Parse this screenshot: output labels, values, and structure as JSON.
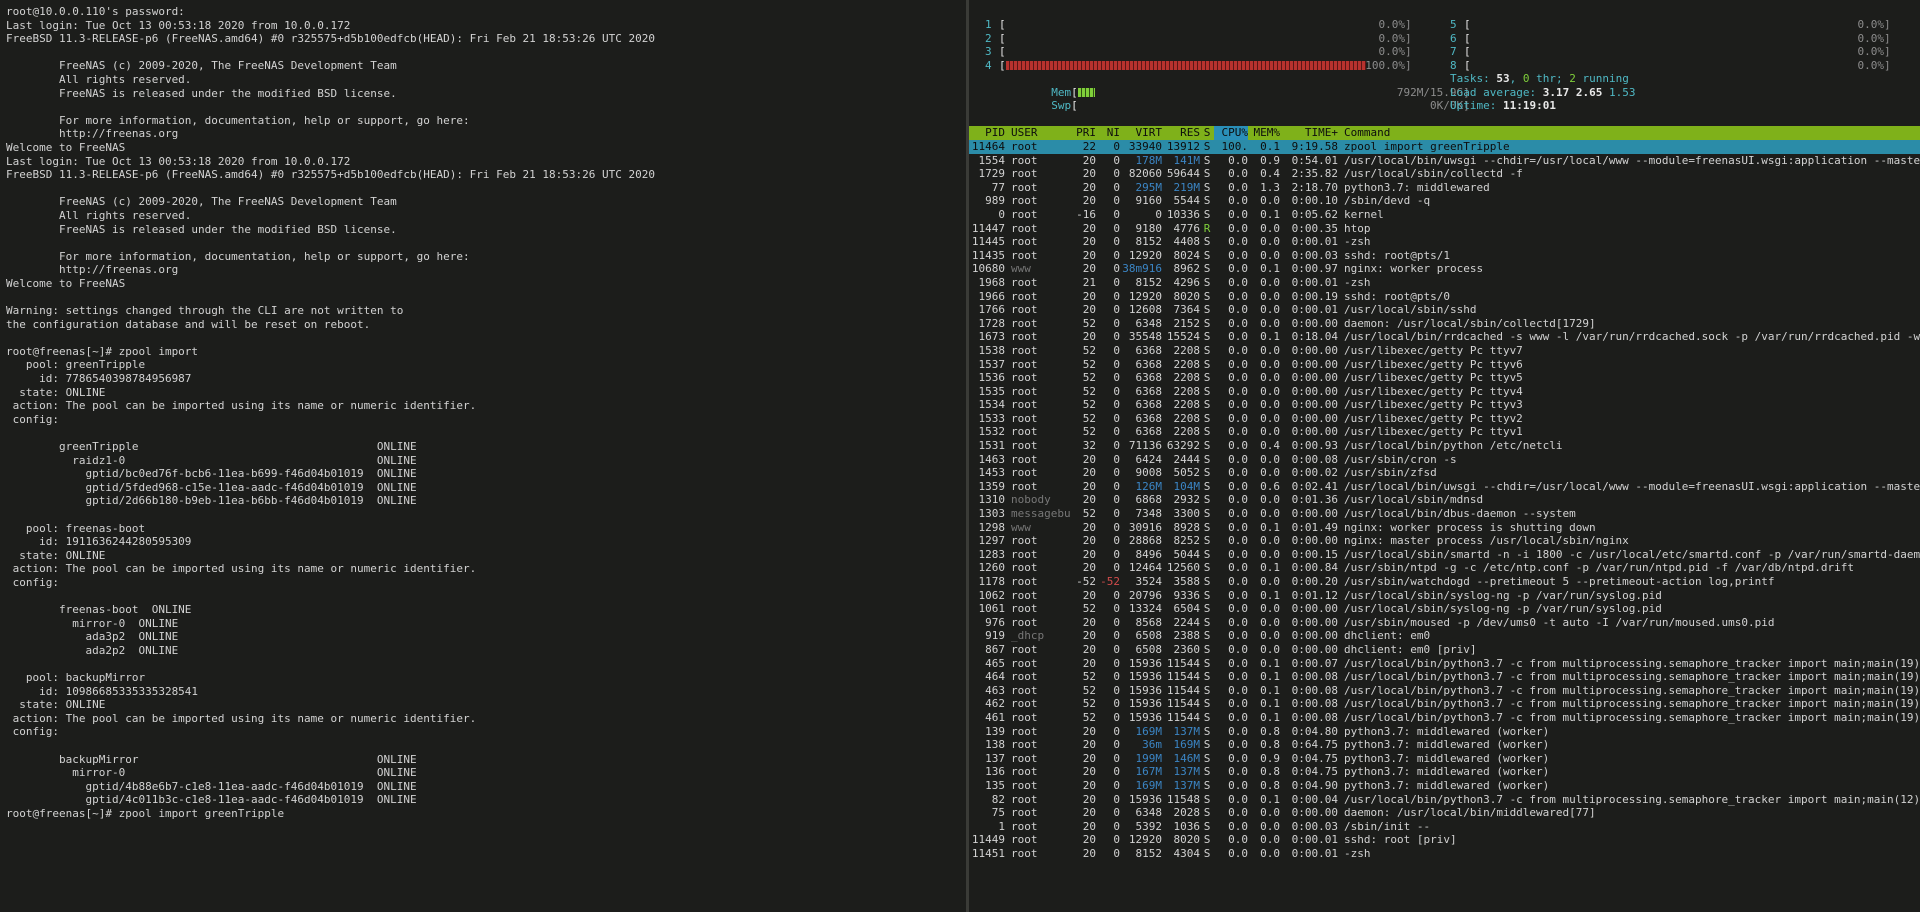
{
  "left_terminal": {
    "lines": [
      "root@10.0.0.110's password:",
      "Last login: Tue Oct 13 00:53:18 2020 from 10.0.0.172",
      "FreeBSD 11.3-RELEASE-p6 (FreeNAS.amd64) #0 r325575+d5b100edfcb(HEAD): Fri Feb 21 18:53:26 UTC 2020",
      "",
      "        FreeNAS (c) 2009-2020, The FreeNAS Development Team",
      "        All rights reserved.",
      "        FreeNAS is released under the modified BSD license.",
      "",
      "        For more information, documentation, help or support, go here:",
      "        http://freenas.org",
      "Welcome to FreeNAS",
      "Last login: Tue Oct 13 00:53:18 2020 from 10.0.0.172",
      "FreeBSD 11.3-RELEASE-p6 (FreeNAS.amd64) #0 r325575+d5b100edfcb(HEAD): Fri Feb 21 18:53:26 UTC 2020",
      "",
      "        FreeNAS (c) 2009-2020, The FreeNAS Development Team",
      "        All rights reserved.",
      "        FreeNAS is released under the modified BSD license.",
      "",
      "        For more information, documentation, help or support, go here:",
      "        http://freenas.org",
      "Welcome to FreeNAS",
      "",
      "Warning: settings changed through the CLI are not written to",
      "the configuration database and will be reset on reboot.",
      "",
      "root@freenas[~]# zpool import",
      "   pool: greenTripple",
      "     id: 7786540398784956987",
      "  state: ONLINE",
      " action: The pool can be imported using its name or numeric identifier.",
      " config:",
      "",
      "        greenTripple                                    ONLINE",
      "          raidz1-0                                      ONLINE",
      "            gptid/bc0ed76f-bcb6-11ea-b699-f46d04b01019  ONLINE",
      "            gptid/5fded968-c15e-11ea-aadc-f46d04b01019  ONLINE",
      "            gptid/2d66b180-b9eb-11ea-b6bb-f46d04b01019  ONLINE",
      "",
      "   pool: freenas-boot",
      "     id: 1911636244280595309",
      "  state: ONLINE",
      " action: The pool can be imported using its name or numeric identifier.",
      " config:",
      "",
      "        freenas-boot  ONLINE",
      "          mirror-0  ONLINE",
      "            ada3p2  ONLINE",
      "            ada2p2  ONLINE",
      "",
      "   pool: backupMirror",
      "     id: 10986685335335328541",
      "  state: ONLINE",
      " action: The pool can be imported using its name or numeric identifier.",
      " config:",
      "",
      "        backupMirror                                    ONLINE",
      "          mirror-0                                      ONLINE",
      "            gptid/4b88e6b7-c1e8-11ea-aadc-f46d04b01019  ONLINE",
      "            gptid/4c011b3c-c1e8-11ea-aadc-f46d04b01019  ONLINE",
      "root@freenas[~]# zpool import greenTripple"
    ]
  },
  "htop": {
    "cpu_meters": [
      {
        "label": "1",
        "percent": 0.0,
        "text": "0.0%]"
      },
      {
        "label": "2",
        "percent": 0.0,
        "text": "0.0%]"
      },
      {
        "label": "3",
        "percent": 0.0,
        "text": "0.0%]"
      },
      {
        "label": "4",
        "percent": 100.0,
        "text": "100.0%]"
      },
      {
        "label": "5",
        "percent": 0.0,
        "text": "0.0%]"
      },
      {
        "label": "6",
        "percent": 0.0,
        "text": "0.0%]"
      },
      {
        "label": "7",
        "percent": 0.0,
        "text": "0.0%]"
      },
      {
        "label": "8",
        "percent": 0.0,
        "text": "0.0%]"
      }
    ],
    "mem": {
      "label": "Mem",
      "text": "792M/15.9G]",
      "fraction": 0.05
    },
    "swp": {
      "label": "Swp",
      "text": "0K/0K]",
      "fraction": 0.0
    },
    "tasks": {
      "label": "Tasks:",
      "count": "53",
      "thr": "0",
      "thr_label": "thr;",
      "running": "2",
      "running_label": "running"
    },
    "load": {
      "label": "Load average:",
      "v1": "3.17",
      "v2": "2.65",
      "v3": "1.53"
    },
    "uptime": {
      "label": "Uptime:",
      "value": "11:19:01"
    },
    "columns": [
      "PID",
      "USER",
      "PRI",
      "NI",
      "VIRT",
      "RES",
      "S",
      "CPU%",
      "MEM%",
      "TIME+",
      "Command"
    ],
    "processes": [
      [
        "11464",
        "root",
        "22",
        "0",
        "33940",
        "13912",
        "S",
        "100.",
        "0.1",
        "9:19.58",
        "zpool import greenTripple"
      ],
      [
        "1554",
        "root",
        "20",
        "0",
        "178M",
        "141M",
        "S",
        "0.0",
        "0.9",
        "0:54.01",
        "/usr/local/bin/uwsgi --chdir=/usr/local/www --module=freenasUI.wsgi:application --master"
      ],
      [
        "1729",
        "root",
        "20",
        "0",
        "82060",
        "59644",
        "S",
        "0.0",
        "0.4",
        "2:35.82",
        "/usr/local/sbin/collectd -f"
      ],
      [
        "77",
        "root",
        "20",
        "0",
        "295M",
        "219M",
        "S",
        "0.0",
        "1.3",
        "2:18.70",
        "python3.7: middlewared"
      ],
      [
        "989",
        "root",
        "20",
        "0",
        "9160",
        "5544",
        "S",
        "0.0",
        "0.0",
        "0:00.10",
        "/sbin/devd -q"
      ],
      [
        "0",
        "root",
        "-16",
        "0",
        "0",
        "10336",
        "S",
        "0.0",
        "0.1",
        "0:05.62",
        "kernel"
      ],
      [
        "11447",
        "root",
        "20",
        "0",
        "9180",
        "4776",
        "R",
        "0.0",
        "0.0",
        "0:00.35",
        "htop"
      ],
      [
        "11445",
        "root",
        "20",
        "0",
        "8152",
        "4408",
        "S",
        "0.0",
        "0.0",
        "0:00.01",
        "-zsh"
      ],
      [
        "11435",
        "root",
        "20",
        "0",
        "12920",
        "8024",
        "S",
        "0.0",
        "0.0",
        "0:00.03",
        "sshd: root@pts/1"
      ],
      [
        "10680",
        "www",
        "20",
        "0",
        "38m916",
        "8962",
        "S",
        "0.0",
        "0.1",
        "0:00.97",
        "nginx: worker process"
      ],
      [
        "1968",
        "root",
        "21",
        "0",
        "8152",
        "4296",
        "S",
        "0.0",
        "0.0",
        "0:00.01",
        "-zsh"
      ],
      [
        "1966",
        "root",
        "20",
        "0",
        "12920",
        "8020",
        "S",
        "0.0",
        "0.0",
        "0:00.19",
        "sshd: root@pts/0"
      ],
      [
        "1766",
        "root",
        "20",
        "0",
        "12608",
        "7364",
        "S",
        "0.0",
        "0.0",
        "0:00.01",
        "/usr/local/sbin/sshd"
      ],
      [
        "1728",
        "root",
        "52",
        "0",
        "6348",
        "2152",
        "S",
        "0.0",
        "0.0",
        "0:00.00",
        "daemon: /usr/local/sbin/collectd[1729]"
      ],
      [
        "1673",
        "root",
        "20",
        "0",
        "35548",
        "15524",
        "S",
        "0.0",
        "0.1",
        "0:18.04",
        "/usr/local/bin/rrdcached -s www -l /var/run/rrdcached.sock -p /var/run/rrdcached.pid -w"
      ],
      [
        "1538",
        "root",
        "52",
        "0",
        "6368",
        "2208",
        "S",
        "0.0",
        "0.0",
        "0:00.00",
        "/usr/libexec/getty Pc ttyv7"
      ],
      [
        "1537",
        "root",
        "52",
        "0",
        "6368",
        "2208",
        "S",
        "0.0",
        "0.0",
        "0:00.00",
        "/usr/libexec/getty Pc ttyv6"
      ],
      [
        "1536",
        "root",
        "52",
        "0",
        "6368",
        "2208",
        "S",
        "0.0",
        "0.0",
        "0:00.00",
        "/usr/libexec/getty Pc ttyv5"
      ],
      [
        "1535",
        "root",
        "52",
        "0",
        "6368",
        "2208",
        "S",
        "0.0",
        "0.0",
        "0:00.00",
        "/usr/libexec/getty Pc ttyv4"
      ],
      [
        "1534",
        "root",
        "52",
        "0",
        "6368",
        "2208",
        "S",
        "0.0",
        "0.0",
        "0:00.00",
        "/usr/libexec/getty Pc ttyv3"
      ],
      [
        "1533",
        "root",
        "52",
        "0",
        "6368",
        "2208",
        "S",
        "0.0",
        "0.0",
        "0:00.00",
        "/usr/libexec/getty Pc ttyv2"
      ],
      [
        "1532",
        "root",
        "52",
        "0",
        "6368",
        "2208",
        "S",
        "0.0",
        "0.0",
        "0:00.00",
        "/usr/libexec/getty Pc ttyv1"
      ],
      [
        "1531",
        "root",
        "32",
        "0",
        "71136",
        "63292",
        "S",
        "0.0",
        "0.4",
        "0:00.93",
        "/usr/local/bin/python /etc/netcli"
      ],
      [
        "1463",
        "root",
        "20",
        "0",
        "6424",
        "2444",
        "S",
        "0.0",
        "0.0",
        "0:00.08",
        "/usr/sbin/cron -s"
      ],
      [
        "1453",
        "root",
        "20",
        "0",
        "9008",
        "5052",
        "S",
        "0.0",
        "0.0",
        "0:00.02",
        "/usr/sbin/zfsd"
      ],
      [
        "1359",
        "root",
        "20",
        "0",
        "126M",
        "104M",
        "S",
        "0.0",
        "0.6",
        "0:02.41",
        "/usr/local/bin/uwsgi --chdir=/usr/local/www --module=freenasUI.wsgi:application --master"
      ],
      [
        "1310",
        "nobody",
        "20",
        "0",
        "6868",
        "2932",
        "S",
        "0.0",
        "0.0",
        "0:01.36",
        "/usr/local/sbin/mdnsd"
      ],
      [
        "1303",
        "messagebu",
        "52",
        "0",
        "7348",
        "3300",
        "S",
        "0.0",
        "0.0",
        "0:00.00",
        "/usr/local/bin/dbus-daemon --system"
      ],
      [
        "1298",
        "www",
        "20",
        "0",
        "30916",
        "8928",
        "S",
        "0.0",
        "0.1",
        "0:01.49",
        "nginx: worker process is shutting down"
      ],
      [
        "1297",
        "root",
        "20",
        "0",
        "28868",
        "8252",
        "S",
        "0.0",
        "0.0",
        "0:00.00",
        "nginx: master process /usr/local/sbin/nginx"
      ],
      [
        "1283",
        "root",
        "20",
        "0",
        "8496",
        "5044",
        "S",
        "0.0",
        "0.0",
        "0:00.15",
        "/usr/local/sbin/smartd -n -i 1800 -c /usr/local/etc/smartd.conf -p /var/run/smartd-daemo"
      ],
      [
        "1260",
        "root",
        "20",
        "0",
        "12464",
        "12560",
        "S",
        "0.0",
        "0.1",
        "0:00.84",
        "/usr/sbin/ntpd -g -c /etc/ntp.conf -p /var/run/ntpd.pid -f /var/db/ntpd.drift"
      ],
      [
        "1178",
        "root",
        "-52",
        "-52",
        "3524",
        "3588",
        "S",
        "0.0",
        "0.0",
        "0:00.20",
        "/usr/sbin/watchdogd --pretimeout 5 --pretimeout-action log,printf"
      ],
      [
        "1062",
        "root",
        "20",
        "0",
        "20796",
        "9336",
        "S",
        "0.0",
        "0.1",
        "0:01.12",
        "/usr/local/sbin/syslog-ng -p /var/run/syslog.pid"
      ],
      [
        "1061",
        "root",
        "52",
        "0",
        "13324",
        "6504",
        "S",
        "0.0",
        "0.0",
        "0:00.00",
        "/usr/local/sbin/syslog-ng -p /var/run/syslog.pid"
      ],
      [
        "976",
        "root",
        "20",
        "0",
        "8568",
        "2244",
        "S",
        "0.0",
        "0.0",
        "0:00.00",
        "/usr/sbin/moused -p /dev/ums0 -t auto -I /var/run/moused.ums0.pid"
      ],
      [
        "919",
        "_dhcp",
        "20",
        "0",
        "6508",
        "2388",
        "S",
        "0.0",
        "0.0",
        "0:00.00",
        "dhclient: em0"
      ],
      [
        "867",
        "root",
        "20",
        "0",
        "6508",
        "2360",
        "S",
        "0.0",
        "0.0",
        "0:00.00",
        "dhclient: em0 [priv]"
      ],
      [
        "465",
        "root",
        "20",
        "0",
        "15936",
        "11544",
        "S",
        "0.0",
        "0.1",
        "0:00.07",
        "/usr/local/bin/python3.7 -c from multiprocessing.semaphore_tracker import main;main(19)"
      ],
      [
        "464",
        "root",
        "52",
        "0",
        "15936",
        "11544",
        "S",
        "0.0",
        "0.1",
        "0:00.08",
        "/usr/local/bin/python3.7 -c from multiprocessing.semaphore_tracker import main;main(19)"
      ],
      [
        "463",
        "root",
        "52",
        "0",
        "15936",
        "11544",
        "S",
        "0.0",
        "0.1",
        "0:00.08",
        "/usr/local/bin/python3.7 -c from multiprocessing.semaphore_tracker import main;main(19)"
      ],
      [
        "462",
        "root",
        "52",
        "0",
        "15936",
        "11544",
        "S",
        "0.0",
        "0.1",
        "0:00.08",
        "/usr/local/bin/python3.7 -c from multiprocessing.semaphore_tracker import main;main(19)"
      ],
      [
        "461",
        "root",
        "52",
        "0",
        "15936",
        "11544",
        "S",
        "0.0",
        "0.1",
        "0:00.08",
        "/usr/local/bin/python3.7 -c from multiprocessing.semaphore_tracker import main;main(19)"
      ],
      [
        "139",
        "root",
        "20",
        "0",
        "169M",
        "137M",
        "S",
        "0.0",
        "0.8",
        "0:04.80",
        "python3.7: middlewared (worker)"
      ],
      [
        "138",
        "root",
        "20",
        "0",
        "36m",
        "169M",
        "S",
        "0.0",
        "0.8",
        "0:64.75",
        "python3.7: middlewared (worker)"
      ],
      [
        "137",
        "root",
        "20",
        "0",
        "199M",
        "146M",
        "S",
        "0.0",
        "0.9",
        "0:04.75",
        "python3.7: middlewared (worker)"
      ],
      [
        "136",
        "root",
        "20",
        "0",
        "167M",
        "137M",
        "S",
        "0.0",
        "0.8",
        "0:04.75",
        "python3.7: middlewared (worker)"
      ],
      [
        "135",
        "root",
        "20",
        "0",
        "169M",
        "137M",
        "S",
        "0.0",
        "0.8",
        "0:04.90",
        "python3.7: middlewared (worker)"
      ],
      [
        "82",
        "root",
        "20",
        "0",
        "15936",
        "11548",
        "S",
        "0.0",
        "0.1",
        "0:00.04",
        "/usr/local/bin/python3.7 -c from multiprocessing.semaphore_tracker import main;main(12)"
      ],
      [
        "75",
        "root",
        "20",
        "0",
        "6348",
        "2028",
        "S",
        "0.0",
        "0.0",
        "0:00.00",
        "daemon: /usr/local/bin/middlewared[77]"
      ],
      [
        "1",
        "root",
        "20",
        "0",
        "5392",
        "1036",
        "S",
        "0.0",
        "0.0",
        "0:00.03",
        "/sbin/init --"
      ],
      [
        "11449",
        "root",
        "20",
        "0",
        "12920",
        "8020",
        "S",
        "0.0",
        "0.0",
        "0:00.01",
        "sshd: root [priv]"
      ],
      [
        "11451",
        "root",
        "20",
        "0",
        "8152",
        "4304",
        "S",
        "0.0",
        "0.0",
        "0:00.01",
        "-zsh"
      ]
    ],
    "colors": {
      "header_bg": "#7fb11a",
      "selected_bg": "#2b8ca8",
      "meter_red": "#b8322e",
      "meter_green": "#7fcf3a",
      "cyan": "#4fb8c4"
    }
  }
}
